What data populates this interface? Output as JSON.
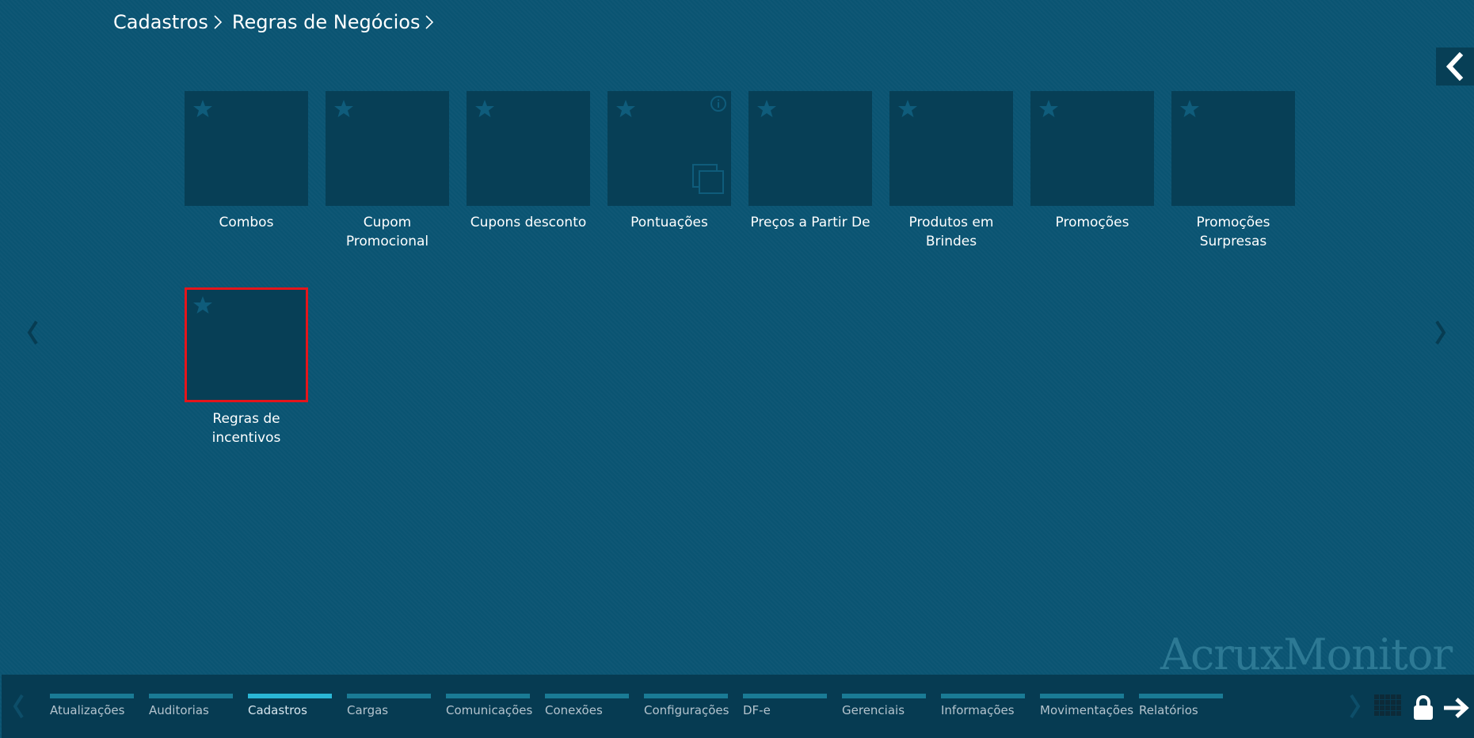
{
  "breadcrumb": {
    "items": [
      "Cadastros",
      "Regras de Negócios"
    ]
  },
  "tiles": [
    {
      "label": "Combos",
      "selected": false,
      "info": false,
      "copy": false
    },
    {
      "label": "Cupom Promocional",
      "selected": false,
      "info": false,
      "copy": false
    },
    {
      "label": "Cupons desconto",
      "selected": false,
      "info": false,
      "copy": false
    },
    {
      "label": "Pontuações",
      "selected": false,
      "info": true,
      "copy": true
    },
    {
      "label": "Preços a Partir De",
      "selected": false,
      "info": false,
      "copy": false
    },
    {
      "label": "Produtos em Brindes",
      "selected": false,
      "info": false,
      "copy": false
    },
    {
      "label": "Promoções",
      "selected": false,
      "info": false,
      "copy": false
    },
    {
      "label": "Promoções Surpresas",
      "selected": false,
      "info": false,
      "copy": false
    },
    {
      "label": "Regras de incentivos",
      "selected": true,
      "info": false,
      "copy": false
    }
  ],
  "watermark": "AcruxMonitor",
  "footer": {
    "tabs": [
      {
        "label": "Atualizações",
        "active": false
      },
      {
        "label": "Auditorias",
        "active": false
      },
      {
        "label": "Cadastros",
        "active": true
      },
      {
        "label": "Cargas",
        "active": false
      },
      {
        "label": "Comunicações",
        "active": false
      },
      {
        "label": "Conexões",
        "active": false
      },
      {
        "label": "Configurações",
        "active": false
      },
      {
        "label": "DF-e",
        "active": false
      },
      {
        "label": "Gerenciais",
        "active": false
      },
      {
        "label": "Informações",
        "active": false
      },
      {
        "label": "Movimentações",
        "active": false
      },
      {
        "label": "Relatórios",
        "active": false
      }
    ]
  },
  "icons": {
    "tile_star": "star-icon",
    "tile_info": "info-icon",
    "tile_copy": "copy-icon",
    "collapse": "chevron-left-icon",
    "page_prev": "chevron-left-icon",
    "page_next": "chevron-right-icon",
    "apps": "grid-icon",
    "lock": "lock-icon",
    "logout": "arrow-right-icon"
  },
  "colors": {
    "background": "#0a5472",
    "tile": "#073f56",
    "selected_border": "#e5151b",
    "active_tab": "#2ab7d6",
    "tab": "#1a7b95"
  }
}
